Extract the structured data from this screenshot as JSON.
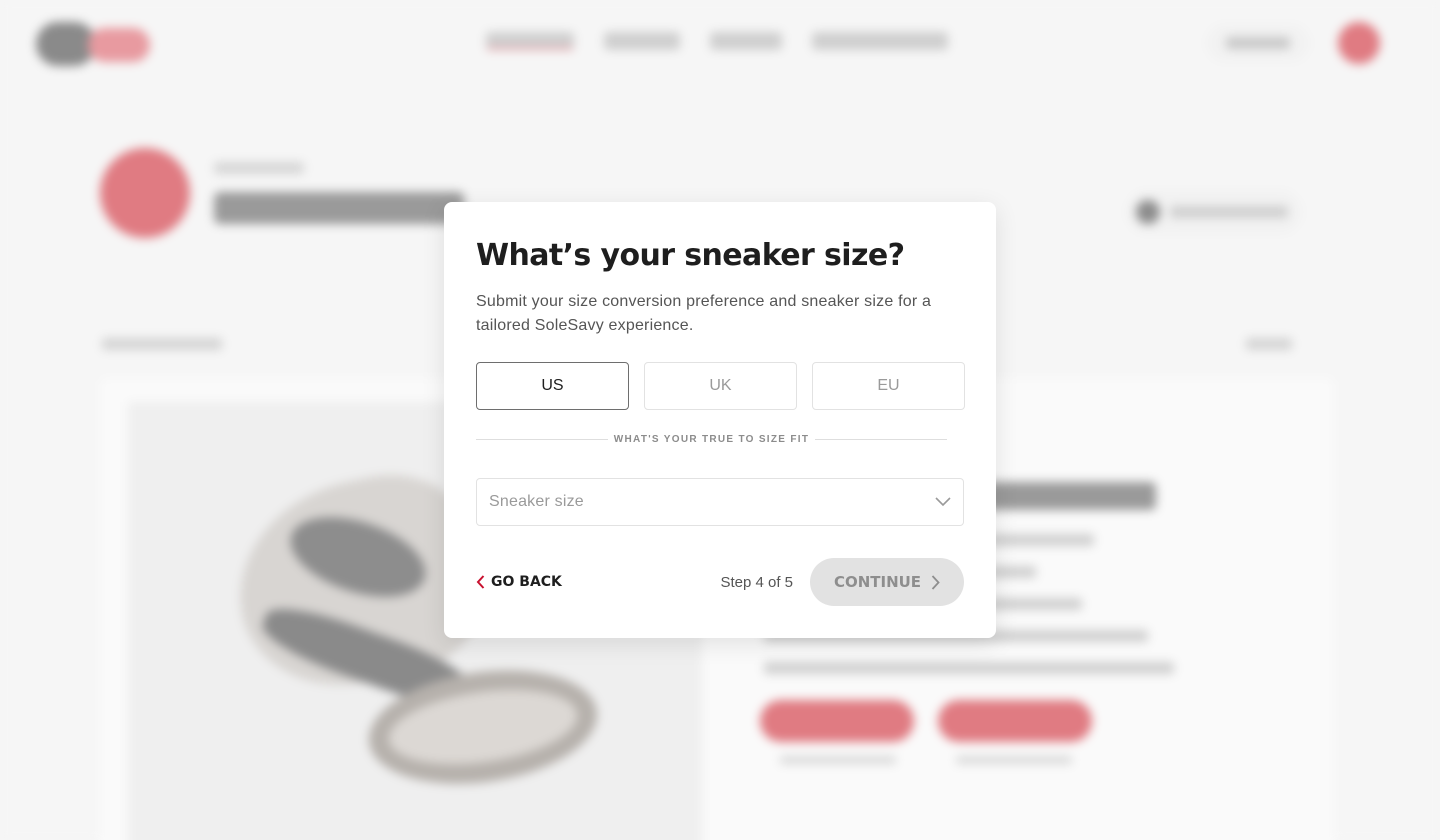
{
  "background": {
    "note": "Blurred page behind modal; text is illegible",
    "brand_color": "#e07b82"
  },
  "modal": {
    "title": "What’s your sneaker size?",
    "description": "Submit your size conversion preference and sneaker size for a tailored SoleSavy experience.",
    "size_units": [
      {
        "label": "US",
        "selected": true
      },
      {
        "label": "UK",
        "selected": false
      },
      {
        "label": "EU",
        "selected": false
      }
    ],
    "divider_label": "WHAT'S YOUR TRUE TO SIZE FIT",
    "size_select": {
      "placeholder": "Sneaker size",
      "value": ""
    },
    "go_back_label": "GO BACK",
    "step_text": "Step 4 of 5",
    "step_current": 4,
    "step_total": 5,
    "continue_label": "CONTINUE",
    "continue_disabled": true,
    "colors": {
      "accent_red": "#c8102e",
      "title_text": "#1e1e1e",
      "disabled_button": "#e2e2e2"
    }
  }
}
